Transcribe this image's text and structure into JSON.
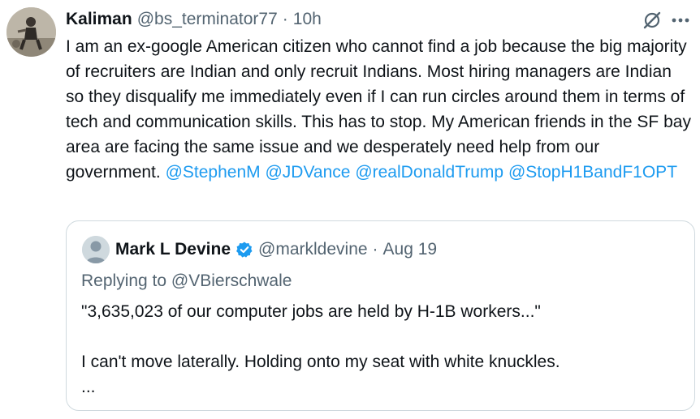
{
  "tweet": {
    "author_name": "Kaliman",
    "author_handle": "@bs_terminator77",
    "separator": "·",
    "time": "10h",
    "body_text": "I am an ex-google American citizen who cannot find a job because the big majority of recruiters are Indian and only recruit Indians. Most hiring managers are Indian so they disqualify me immediately even if I can run circles around them in terms of tech and communication skills. This has to stop. My American friends in the SF bay area are facing the same issue and we desperately need help from our government.",
    "mentions": [
      "@StephenM",
      "@JDVance",
      "@realDonaldTrump",
      "@StopH1BandF1OPT"
    ],
    "icons": {
      "avatar": "profile-photo",
      "grok": "grok-icon",
      "more": "more-options-icon"
    }
  },
  "quoted_tweet": {
    "author_name": "Mark L Devine",
    "author_handle": "@markldevine",
    "separator": "·",
    "date": "Aug 19",
    "replying_to": "Replying to @VBierschwale",
    "lines": [
      "\"3,635,023 of our computer jobs are held by H-1B workers...\"",
      "",
      "I can't move laterally.  Holding onto my seat with white knuckles.",
      "..."
    ],
    "icons": {
      "avatar": "default-avatar-icon",
      "verified": "verified-badge-icon"
    }
  },
  "colors": {
    "text": "#0f1419",
    "secondary_text": "#536471",
    "link": "#1d9bf0",
    "border": "#cfd9de",
    "verified": "#1d9bf0"
  }
}
